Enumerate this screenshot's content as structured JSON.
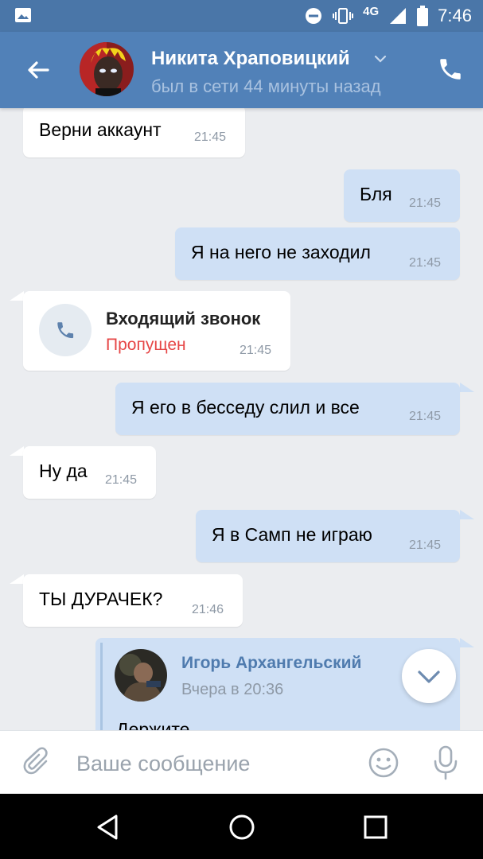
{
  "status_bar": {
    "network": "4G",
    "time": "7:46"
  },
  "header": {
    "name": "Никита Храповицкий",
    "status": "был в сети 44 минуты назад"
  },
  "messages": [
    {
      "dir": "in",
      "text": "Верни аккаунт",
      "time": "21:45"
    },
    {
      "dir": "out",
      "text": "Бля",
      "time": "21:45"
    },
    {
      "dir": "out",
      "text": "Я на него не заходил",
      "time": "21:45"
    },
    {
      "dir": "in",
      "type": "call",
      "title": "Входящий звонок",
      "subtitle": "Пропущен",
      "time": "21:45"
    },
    {
      "dir": "out",
      "text": "Я его в бесседу слил и все",
      "time": "21:45"
    },
    {
      "dir": "in",
      "text": "Ну да",
      "time": "21:45"
    },
    {
      "dir": "out",
      "text": "Я в Самп не играю",
      "time": "21:45"
    },
    {
      "dir": "in",
      "text": "ТЫ ДУРАЧЕК?",
      "time": "21:46"
    },
    {
      "dir": "out",
      "type": "forward",
      "author": "Игорь Архангельский",
      "date": "Вчера в 20:36",
      "text": "Держите"
    }
  ],
  "composer": {
    "placeholder": "Ваше сообщение"
  },
  "colors": {
    "header": "#5181b8",
    "status_bar": "#4a76a8",
    "incoming": "#ffffff",
    "outgoing": "#cfe0f5",
    "missed": "#e64646",
    "background": "#ebedf0"
  },
  "icons": [
    "image-icon",
    "dnd-icon",
    "vibrate-icon",
    "signal-icon",
    "battery-icon",
    "back-arrow-icon",
    "chevron-down-icon",
    "phone-icon",
    "attach-icon",
    "smile-icon",
    "mic-icon",
    "nav-back-icon",
    "nav-home-icon",
    "nav-recents-icon"
  ]
}
